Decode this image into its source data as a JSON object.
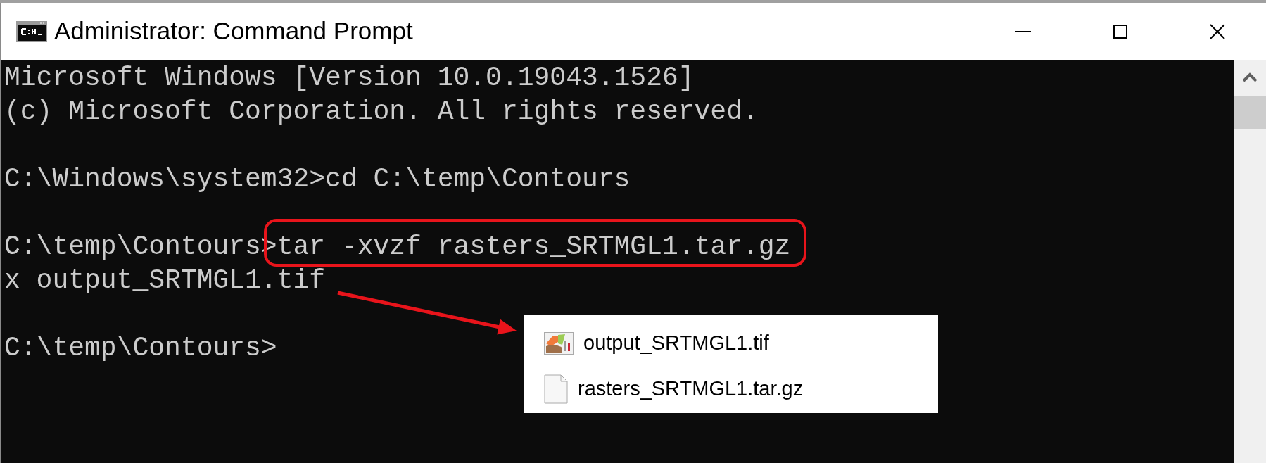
{
  "window": {
    "title": "Administrator: Command Prompt"
  },
  "console": {
    "lines": [
      {
        "kind": "output",
        "text": "Microsoft Windows [Version 10.0.19043.1526]",
        "highlighted": false
      },
      {
        "kind": "output",
        "text": "(c) Microsoft Corporation. All rights reserved.",
        "highlighted": false
      },
      {
        "kind": "blank",
        "highlighted": false
      },
      {
        "kind": "command",
        "prompt": "C:\\Windows\\system32>",
        "text": "cd C:\\temp\\Contours",
        "highlighted": false
      },
      {
        "kind": "blank",
        "highlighted": false
      },
      {
        "kind": "command",
        "prompt": "C:\\temp\\Contours>",
        "text": "tar -xvzf rasters_SRTMGL1.tar.gz",
        "highlighted": true
      },
      {
        "kind": "output",
        "text": "x output_SRTMGL1.tif",
        "highlighted": false
      },
      {
        "kind": "blank",
        "highlighted": false
      },
      {
        "kind": "command",
        "prompt": "C:\\temp\\Contours>",
        "highlighted": false
      }
    ]
  },
  "file_list": {
    "items": [
      {
        "name": "output_SRTMGL1.tif",
        "kind": "image"
      },
      {
        "name": "rasters_SRTMGL1.tar.gz",
        "kind": "file"
      }
    ]
  }
}
